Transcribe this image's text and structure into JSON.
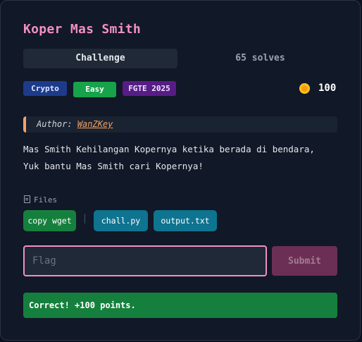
{
  "challenge": {
    "title": "Koper Mas Smith",
    "tabs": {
      "challenge": "Challenge",
      "solves": "65 solves"
    },
    "badges": {
      "category": "Crypto",
      "difficulty": "Easy",
      "event": "FGTE 2025"
    },
    "points": "100",
    "author": {
      "prefix": "Author:",
      "name": "WanZKey"
    },
    "description": "Mas Smith Kehilangan Kopernya ketika berada di bendara,\nYuk bantu Mas Smith cari Kopernya!",
    "files": {
      "label": "Files",
      "copy_wget": "copy wget",
      "items": [
        "chall.py",
        "output.txt"
      ]
    },
    "flag": {
      "placeholder": "Flag",
      "value": ""
    },
    "submit_label": "Submit",
    "result_message": "Correct! +100 points."
  },
  "colors": {
    "title": "#f28fc7",
    "accent_author": "#f4a261",
    "success": "#15803d",
    "file_button": "#0e7490",
    "submit_disabled": "#6b2f55"
  },
  "icons": {
    "points": "coin-icon",
    "files": "file-icon"
  }
}
